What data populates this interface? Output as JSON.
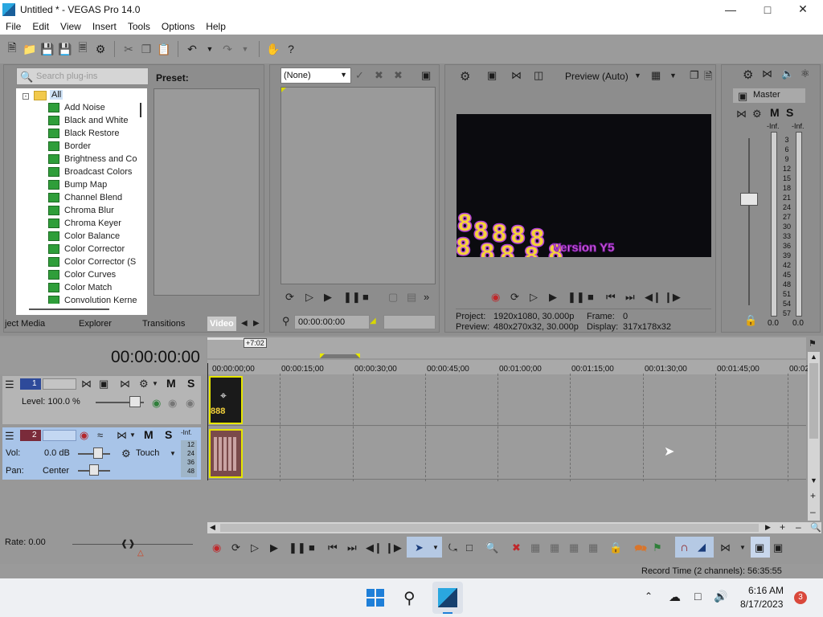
{
  "window": {
    "title": "Untitled * - VEGAS Pro 14.0"
  },
  "menu": [
    "File",
    "Edit",
    "View",
    "Insert",
    "Tools",
    "Options",
    "Help"
  ],
  "explorer": {
    "search_placeholder": "Search plug-ins",
    "preset_label": "Preset:",
    "root_label": "All",
    "plugins": [
      "Add Noise",
      "Black and White",
      "Black Restore",
      "Border",
      "Brightness and Co",
      "Broadcast Colors",
      "Bump Map",
      "Channel Blend",
      "Chroma Blur",
      "Chroma Keyer",
      "Color Balance",
      "Color Corrector",
      "Color Corrector (S",
      "Color Curves",
      "Color Match",
      "Convolution Kerne"
    ],
    "tabs": [
      "ject Media",
      "Explorer",
      "Transitions",
      "Video"
    ]
  },
  "trimmer": {
    "dropdown_value": "(None)",
    "timecode": "00:00:00:00"
  },
  "preview": {
    "mode_label": "Preview (Auto)",
    "overlay_text": "Version Y5",
    "project_label": "Project:",
    "project_value": "1920x1080, 30.000p",
    "preview_label": "Preview:",
    "preview_value": "480x270x32, 30.000p",
    "frame_label": "Frame:",
    "frame_value": "0",
    "display_label": "Display:",
    "display_value": "317x178x32"
  },
  "mixer": {
    "master_label": "Master",
    "m_label": "M",
    "s_label": "S",
    "inf_left": "-Inf.",
    "inf_right": "-Inf.",
    "scale": [
      "3",
      "6",
      "9",
      "12",
      "15",
      "18",
      "21",
      "24",
      "27",
      "30",
      "33",
      "36",
      "39",
      "42",
      "45",
      "48",
      "51",
      "54",
      "57"
    ],
    "bottom_left": "0.0",
    "bottom_right": "0.0"
  },
  "timeline": {
    "timecode": "00:00:00:00",
    "loop_badge": "+7:02",
    "ruler": [
      "00:00:00;00",
      "00:00:15;00",
      "00:00:30;00",
      "00:00:45;00",
      "00:01:00;00",
      "00:01:15;00",
      "00:01:30;00",
      "00:01:45;00",
      "00:02"
    ],
    "track1": {
      "number": "1",
      "level_label": "Level: 100.0 %",
      "m_label": "M",
      "s_label": "S"
    },
    "track2": {
      "number": "2",
      "vol_label": "Vol:",
      "vol_value": "0.0 dB",
      "pan_label": "Pan:",
      "pan_value": "Center",
      "touch_label": "Touch",
      "m_label": "M",
      "s_label": "S",
      "meter_inf": "-Inf.",
      "meter_scale": [
        "12",
        "24",
        "36",
        "48"
      ]
    },
    "rate_label": "Rate: 0.00"
  },
  "status": {
    "record_time": "Record Time (2 channels): 56:35:55"
  },
  "taskbar": {
    "time": "6:16 AM",
    "date": "8/17/2023",
    "notification_count": "3"
  }
}
